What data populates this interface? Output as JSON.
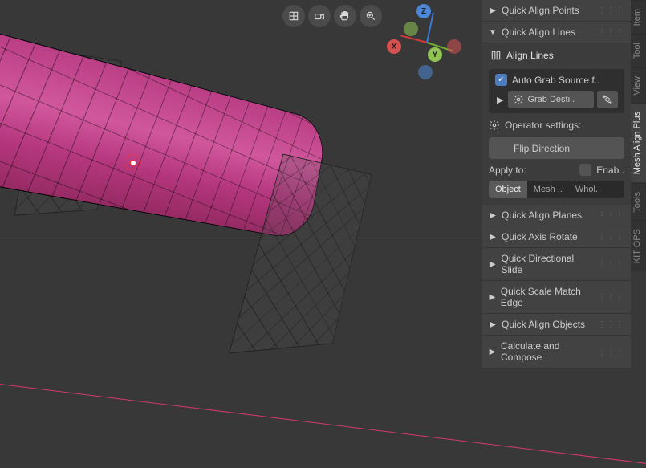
{
  "panels": {
    "collapsed": [
      "Quick Align Points",
      "Quick Align Planes",
      "Quick Axis Rotate",
      "Quick Directional Slide",
      "Quick Scale Match Edge",
      "Quick Align Objects",
      "Calculate and Compose"
    ],
    "expanded": {
      "title": "Quick Align Lines",
      "sub_title": "Align Lines",
      "auto_grab": "Auto Grab Source f..",
      "grab_dest": "Grab Desti..",
      "operator_settings": "Operator settings:",
      "flip": "Flip Direction",
      "apply_to": "Apply to:",
      "enable": "Enab..",
      "seg": [
        "Object",
        "Mesh ..",
        "Whol.."
      ]
    }
  },
  "vtabs": [
    "Item",
    "Tool",
    "View",
    "Mesh Align Plus",
    "Tools",
    "KIT OPS"
  ],
  "active_vtab_index": 3,
  "gizmo": {
    "x": "X",
    "y": "Y",
    "z": "Z"
  }
}
